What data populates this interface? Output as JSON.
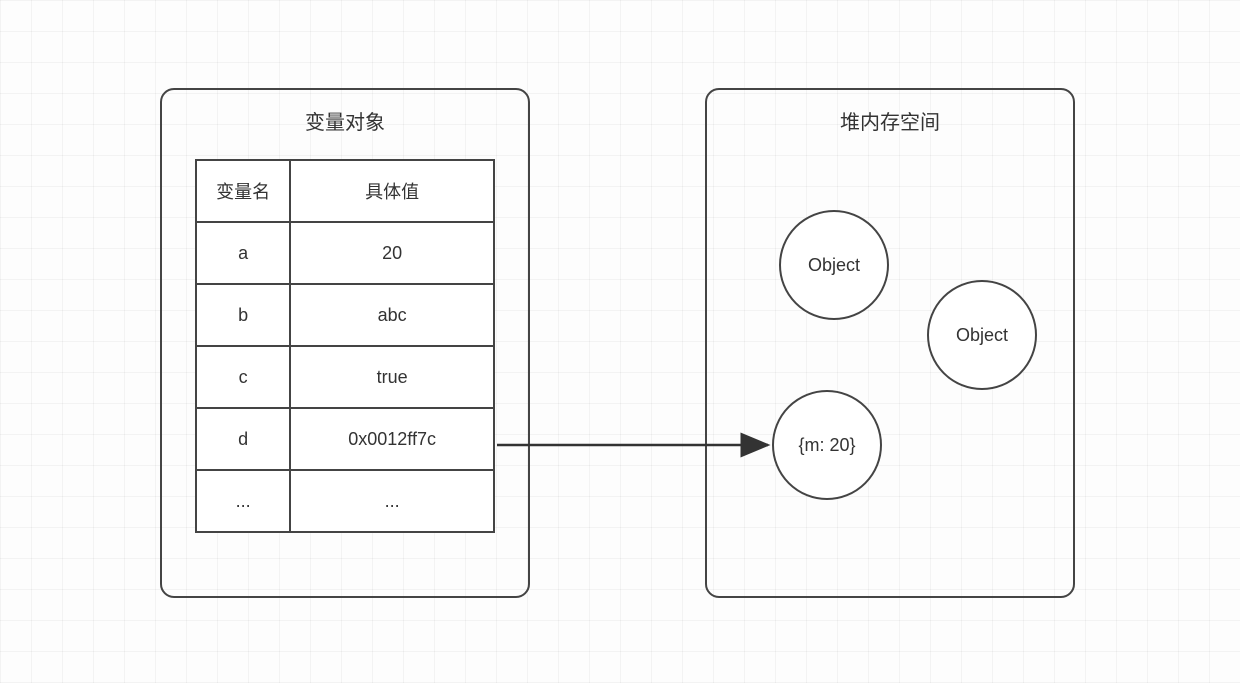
{
  "left_panel": {
    "title": "变量对象",
    "table": {
      "headers": {
        "name": "变量名",
        "value": "具体值"
      },
      "rows": [
        {
          "name": "a",
          "value": "20"
        },
        {
          "name": "b",
          "value": "abc"
        },
        {
          "name": "c",
          "value": "true"
        },
        {
          "name": "d",
          "value": "0x0012ff7c"
        },
        {
          "name": "...",
          "value": "..."
        }
      ]
    }
  },
  "right_panel": {
    "title": "堆内存空间",
    "objects": [
      {
        "id": "obj1",
        "label": "Object"
      },
      {
        "id": "obj2",
        "label": "Object"
      },
      {
        "id": "obj3",
        "label": "{m: 20}"
      }
    ]
  },
  "arrow": {
    "from": "variable d value cell",
    "to": "heap object {m: 20}"
  }
}
